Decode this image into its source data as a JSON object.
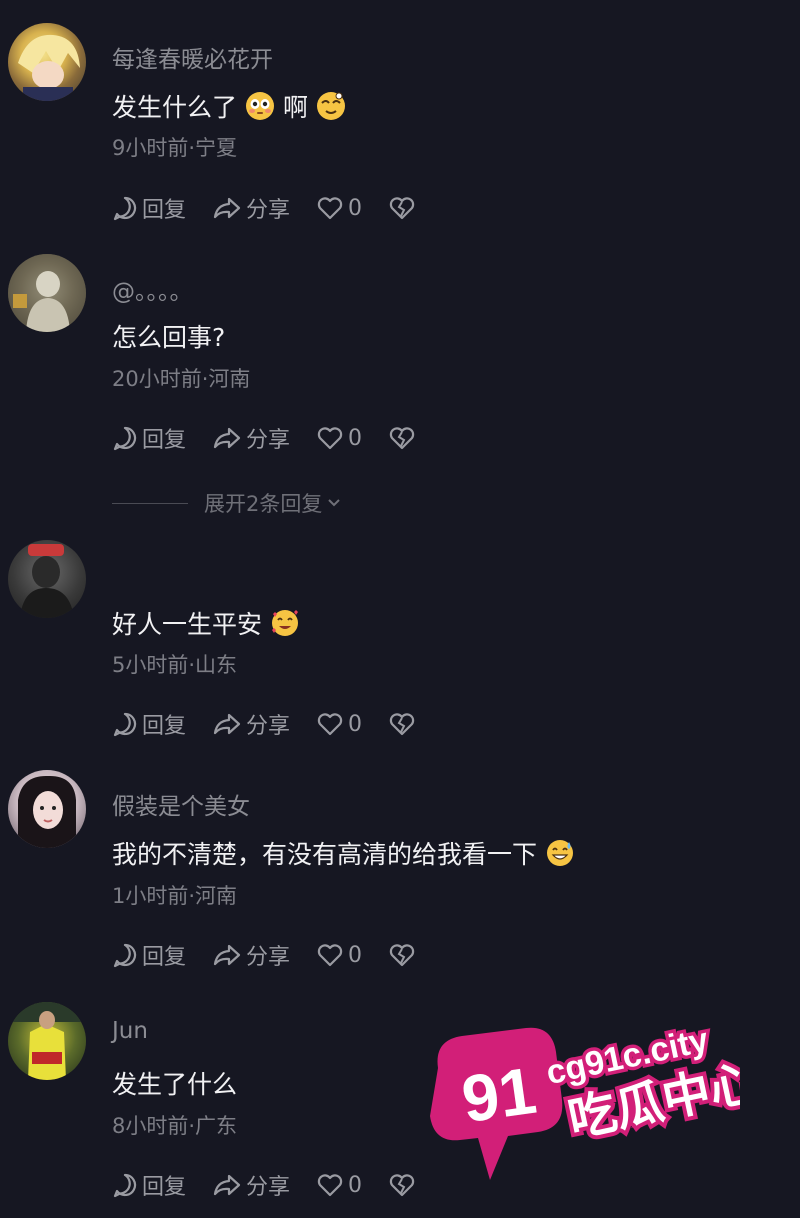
{
  "comments": [
    {
      "username": "每逢春暖必花开",
      "text": "发生什么了",
      "text_suffix": "啊",
      "meta": "9小时前·宁夏",
      "reply_label": "回复",
      "share_label": "分享",
      "like_count": "0"
    },
    {
      "username": "@。。。。",
      "text": "怎么回事?",
      "meta": "20小时前·河南",
      "reply_label": "回复",
      "share_label": "分享",
      "like_count": "0"
    },
    {
      "username": "",
      "text": "好人一生平安",
      "meta": "5小时前·山东",
      "reply_label": "回复",
      "share_label": "分享",
      "like_count": "0"
    },
    {
      "username": "假装是个美女",
      "text": "我的不清楚，有没有高清的给我看一下",
      "meta": "1小时前·河南",
      "reply_label": "回复",
      "share_label": "分享",
      "like_count": "0"
    },
    {
      "username": "Jun",
      "text": "发生了什么",
      "meta": "8小时前·广东",
      "reply_label": "回复",
      "share_label": "分享",
      "like_count": "0"
    }
  ],
  "expand_replies": "展开2条回复",
  "watermark": {
    "number": "91",
    "domain": "cg91c.city",
    "name": "吃瓜中心"
  },
  "colors": {
    "background": "#161722",
    "watermark_pink": "#d21f78"
  }
}
